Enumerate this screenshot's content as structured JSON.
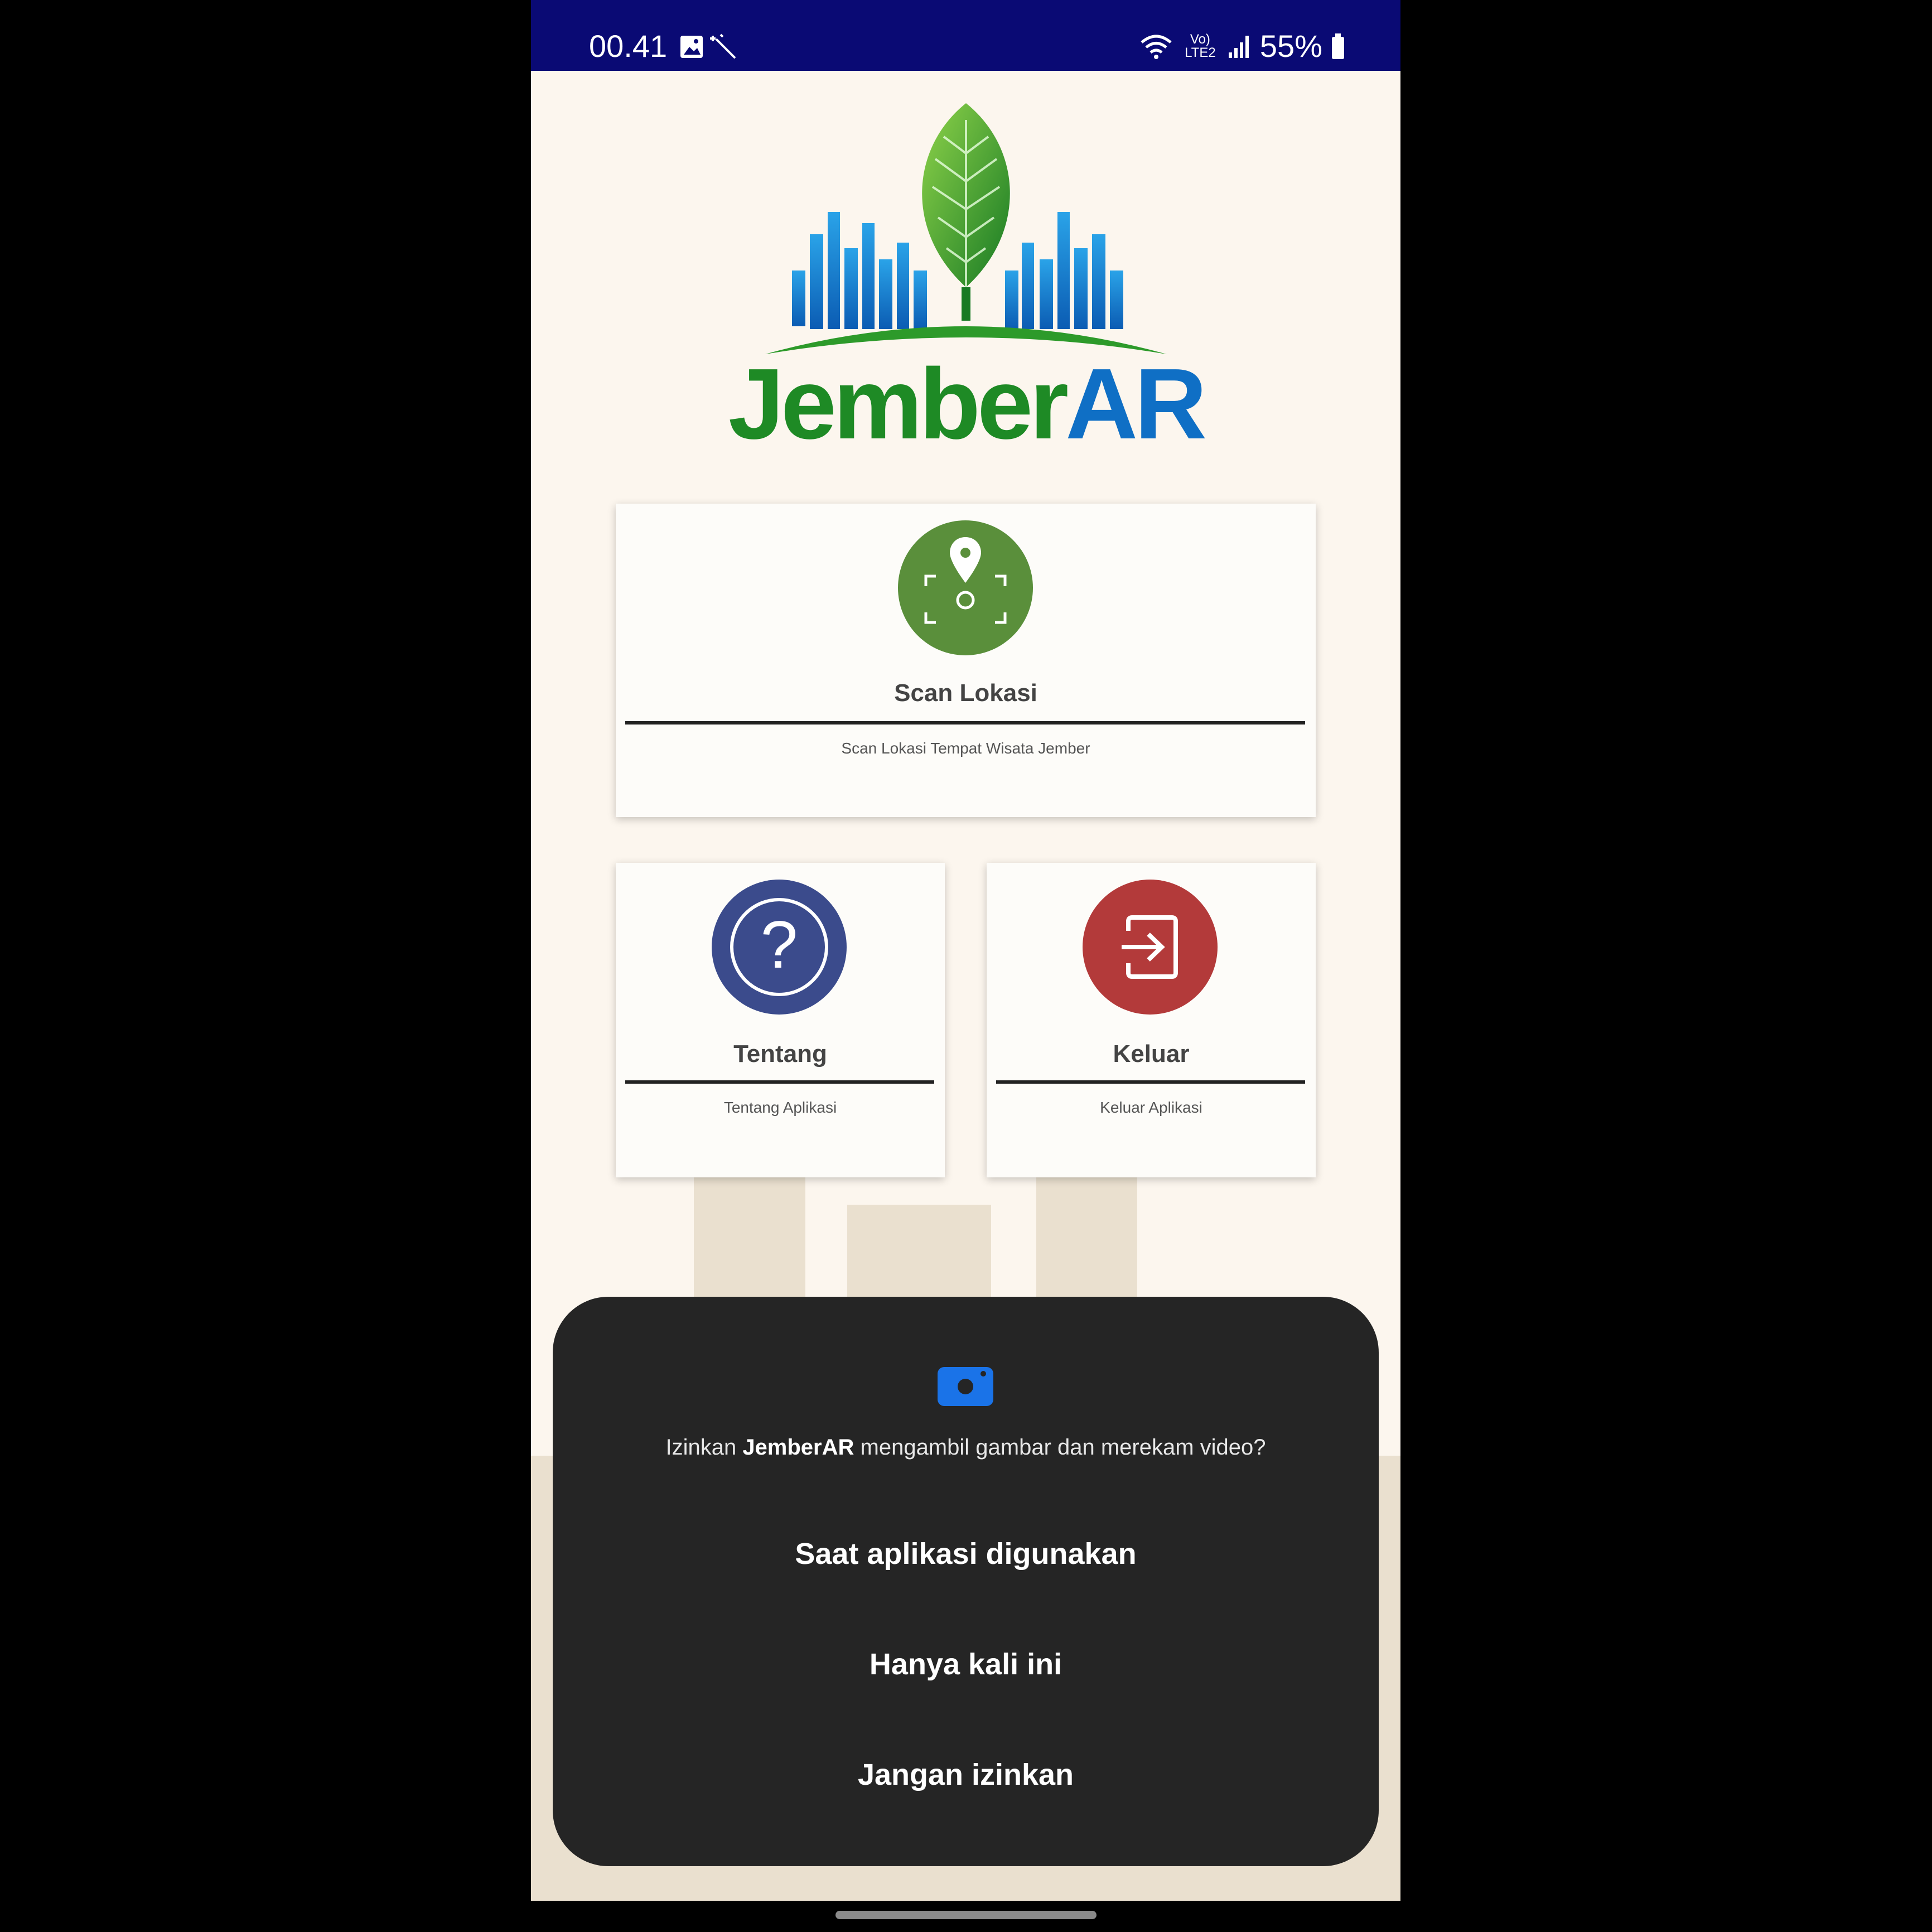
{
  "status_bar": {
    "time": "00.41",
    "network": "Vo) LTE2",
    "battery": "55%"
  },
  "logo": {
    "part1": "Jember",
    "part2": "AR"
  },
  "cards": {
    "scan": {
      "title": "Scan Lokasi",
      "subtitle": "Scan Lokasi Tempat Wisata Jember",
      "color": "#5a8f3b"
    },
    "tentang": {
      "title": "Tentang",
      "subtitle": "Tentang Aplikasi",
      "color": "#3b4b8c"
    },
    "keluar": {
      "title": "Keluar",
      "subtitle": "Keluar Aplikasi",
      "color": "#b33a3a"
    }
  },
  "permission_dialog": {
    "prefix": "Izinkan ",
    "app_name": "JemberAR",
    "suffix": " mengambil gambar dan merekam video?",
    "option_while_using": "Saat aplikasi digunakan",
    "option_only_once": "Hanya kali ini",
    "option_deny": "Jangan izinkan",
    "icon_color": "#1a73e8"
  },
  "colors": {
    "status_bar_bg": "#0a0a74",
    "page_bg": "#fcf6ee",
    "dialog_bg": "#252525"
  }
}
